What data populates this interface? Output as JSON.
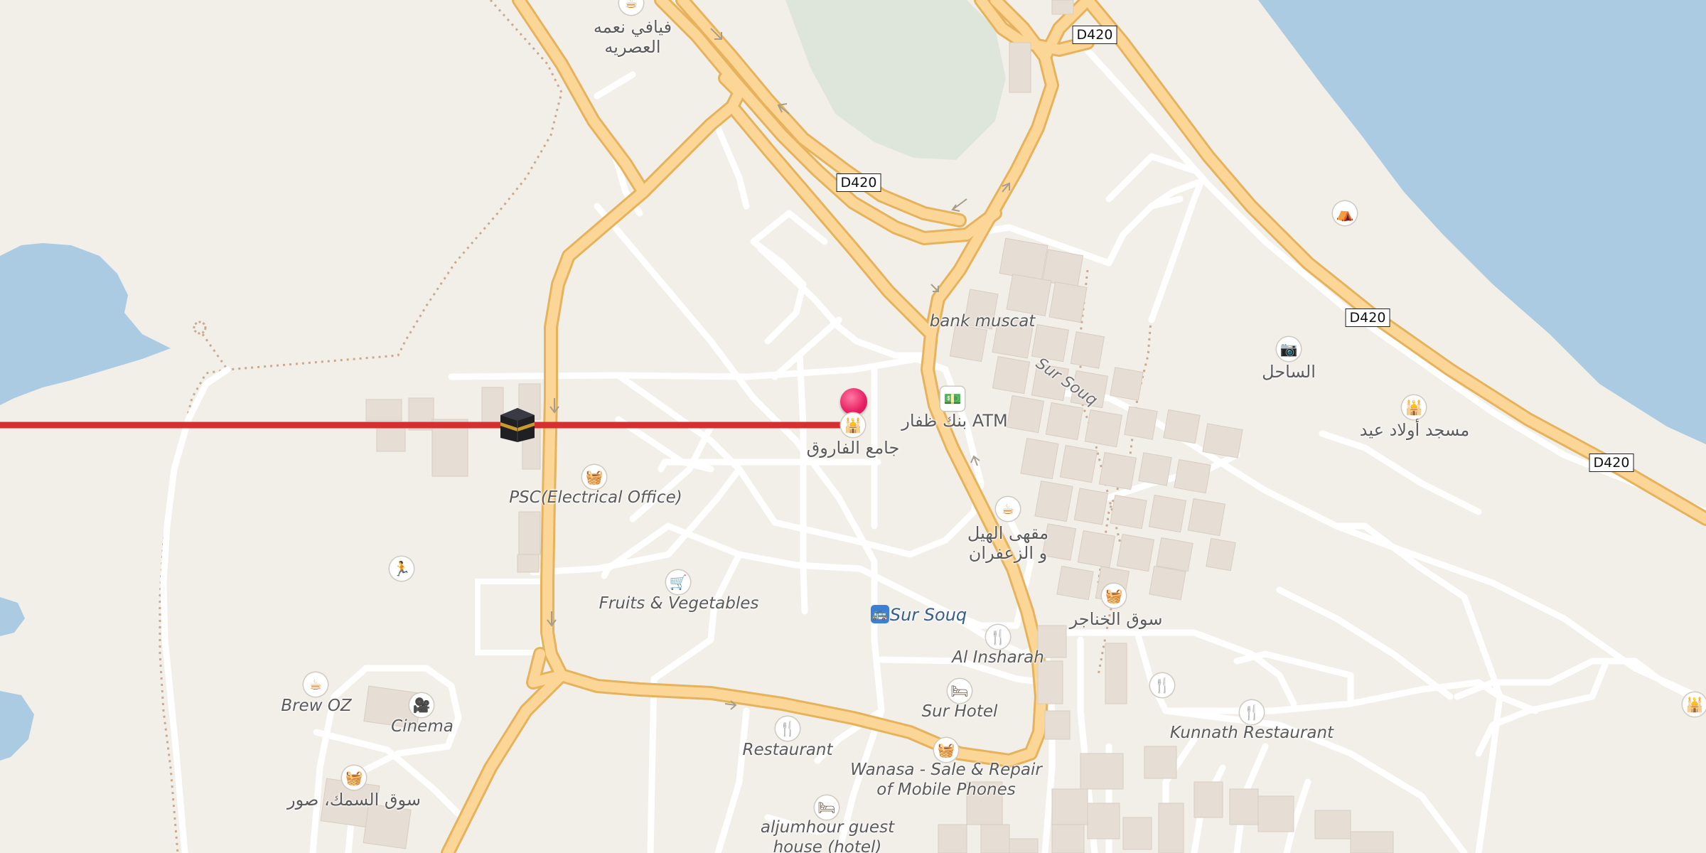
{
  "colors": {
    "land": "#f2efe9",
    "water": "#aacbe2",
    "road_major_fill": "#fbd38f",
    "road_major_casing": "#e8b45f",
    "road_minor": "#ffffff",
    "building": "#e6ddd4",
    "route_line": "#d62f30",
    "pin": "#e81f63"
  },
  "shields": [
    "D420",
    "D420",
    "D420",
    "D420"
  ],
  "labels": {
    "cafe_top": "فيافي نعمه\nالعصريه",
    "bank_muscat": "bank muscat",
    "sur_souq_street": "Sur Souq",
    "alsahel": "الساحل",
    "mosque_awlad_eid": "مسجد أولاد عيد",
    "bank_atm": "بنك ظفار ATM",
    "farooq_mosque": "جامع الفاروق",
    "psc": "PSC(Electrical Office)",
    "cafe_heel": "مقهى الهيل\nو الزعفران",
    "fruits": "Fruits & Vegetables",
    "bus_sur_souq": "Sur Souq",
    "souq_khanjar": "سوق الخناجر",
    "al_insharah": "Al Insharah",
    "sur_hotel": "Sur Hotel",
    "kunnath": "Kunnath Restaurant",
    "brew_oz": "Brew OZ",
    "cinema": "Cinema",
    "restaurant": "Restaurant",
    "wanasa": "Wanasa - Sale & Repair\nof Mobile Phones",
    "fish_market": "سوق السمك، صور",
    "aljumhour": "aljumhour guest\nhouse (hotel)"
  },
  "icons": {
    "cafe": "cafe-cup-icon",
    "shop": "shopping-basket-icon",
    "cart": "shopping-cart-icon",
    "restaurant": "fork-knife-icon",
    "hotel": "bed-icon",
    "mosque": "mosque-icon",
    "atm": "banknote-icon",
    "camera": "camera-icon",
    "picnic": "picnic-table-icon",
    "sport": "running-person-icon",
    "cinema": "movie-camera-icon",
    "bus": "bus-stop-icon",
    "kaaba": "kaaba-icon",
    "pin": "location-pin-icon"
  }
}
